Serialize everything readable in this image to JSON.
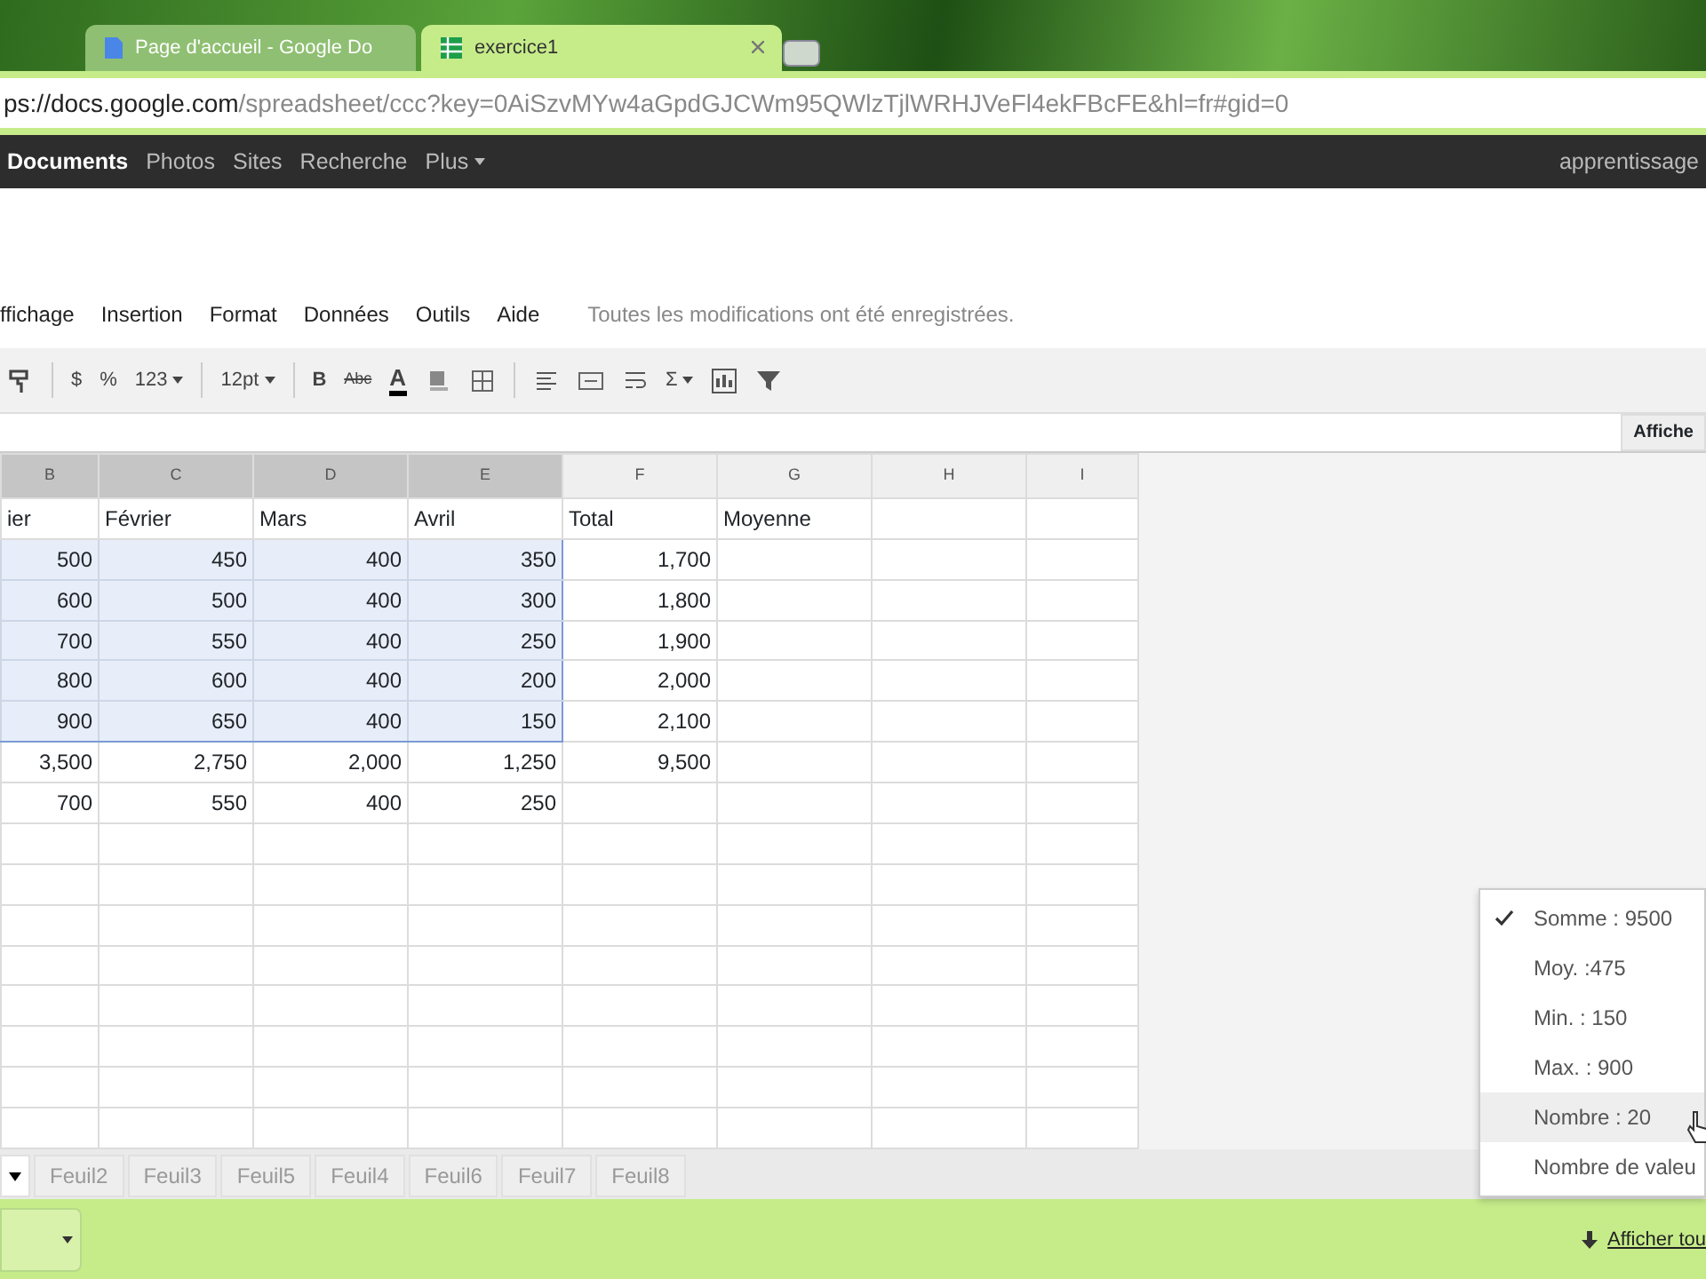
{
  "browser": {
    "tabs": [
      {
        "title": "Page d'accueil - Google Do",
        "selected": false
      },
      {
        "title": "exercice1",
        "selected": true
      }
    ],
    "address": {
      "host": "ps://docs.google.com",
      "path": "/spreadsheet/ccc?key=0AiSzvMYw4aGpdGJCWm95QWlzTjlWRHJVeFl4ekFBcFE&hl=fr#gid=0"
    }
  },
  "google_bar": {
    "items": [
      {
        "label": "Documents",
        "selected": true
      },
      {
        "label": "Photos",
        "selected": false
      },
      {
        "label": "Sites",
        "selected": false
      },
      {
        "label": "Recherche",
        "selected": false
      },
      {
        "label": "Plus",
        "selected": false
      }
    ],
    "account": "apprentissage"
  },
  "menu": {
    "items": [
      "ffichage",
      "Insertion",
      "Format",
      "Données",
      "Outils",
      "Aide"
    ],
    "status": "Toutes les modifications ont été enregistrées."
  },
  "toolbar": [
    {
      "kind": "paint"
    },
    {
      "kind": "sep"
    },
    {
      "kind": "text",
      "text": "$"
    },
    {
      "kind": "text",
      "text": "%"
    },
    {
      "kind": "drop",
      "text": "123"
    },
    {
      "kind": "sep"
    },
    {
      "kind": "drop",
      "text": "12pt"
    },
    {
      "kind": "sep"
    },
    {
      "kind": "bold",
      "text": "B"
    },
    {
      "kind": "strike",
      "text": "Abc"
    },
    {
      "kind": "color",
      "text": "A"
    },
    {
      "kind": "fill"
    },
    {
      "kind": "borders"
    },
    {
      "kind": "sep"
    },
    {
      "kind": "align"
    },
    {
      "kind": "merge"
    },
    {
      "kind": "wrap"
    },
    {
      "kind": "drop",
      "text": "Σ"
    },
    {
      "kind": "chart"
    },
    {
      "kind": "filter"
    }
  ],
  "formula_bar": {
    "button": "Affiche"
  },
  "grid": {
    "columns": [
      {
        "letter": "B",
        "selected": true
      },
      {
        "letter": "C",
        "selected": true
      },
      {
        "letter": "D",
        "selected": true
      },
      {
        "letter": "E",
        "selected": true
      },
      {
        "letter": "F",
        "selected": false
      },
      {
        "letter": "G",
        "selected": false
      },
      {
        "letter": "H",
        "selected": false
      },
      {
        "letter": "I",
        "selected": false
      }
    ],
    "rows": [
      {
        "kind": "label",
        "selected": false,
        "cells": [
          "ier",
          "Février",
          "Mars",
          "Avril",
          "Total",
          "Moyenne"
        ]
      },
      {
        "kind": "number",
        "selected": true,
        "cells": [
          "500",
          "450",
          "400",
          "350",
          "1,700"
        ]
      },
      {
        "kind": "number",
        "selected": true,
        "cells": [
          "600",
          "500",
          "400",
          "300",
          "1,800"
        ]
      },
      {
        "kind": "number",
        "selected": true,
        "cells": [
          "700",
          "550",
          "400",
          "250",
          "1,900"
        ]
      },
      {
        "kind": "number",
        "selected": true,
        "cells": [
          "800",
          "600",
          "400",
          "200",
          "2,000"
        ]
      },
      {
        "kind": "number",
        "selected": true,
        "cells": [
          "900",
          "650",
          "400",
          "150",
          "2,100"
        ]
      },
      {
        "kind": "number",
        "selected": false,
        "cells": [
          "3,500",
          "2,750",
          "2,000",
          "1,250",
          "9,500"
        ]
      },
      {
        "kind": "number",
        "selected": false,
        "cells": [
          "700",
          "550",
          "400",
          "250"
        ]
      }
    ]
  },
  "sheet_tabs": [
    {
      "selected": true
    },
    {
      "label": "Feuil2",
      "selected": false
    },
    {
      "label": "Feuil3",
      "selected": false
    },
    {
      "label": "Feuil5",
      "selected": false
    },
    {
      "label": "Feuil4",
      "selected": false
    },
    {
      "label": "Feuil6",
      "selected": false
    },
    {
      "label": "Feuil7",
      "selected": false
    },
    {
      "label": "Feuil8",
      "selected": false
    }
  ],
  "summary_menu": [
    {
      "label": "Somme : 9500",
      "checked": true,
      "selected": false
    },
    {
      "label": "Moy. :475",
      "checked": false,
      "selected": false
    },
    {
      "label": "Min. : 150",
      "checked": false,
      "selected": false
    },
    {
      "label": "Max. : 900",
      "checked": false,
      "selected": false
    },
    {
      "label": "Nombre : 20",
      "checked": false,
      "selected": true
    },
    {
      "label": "Nombre de valeu",
      "checked": false,
      "selected": false
    }
  ],
  "download_bar": {
    "link": "Afficher tou"
  }
}
